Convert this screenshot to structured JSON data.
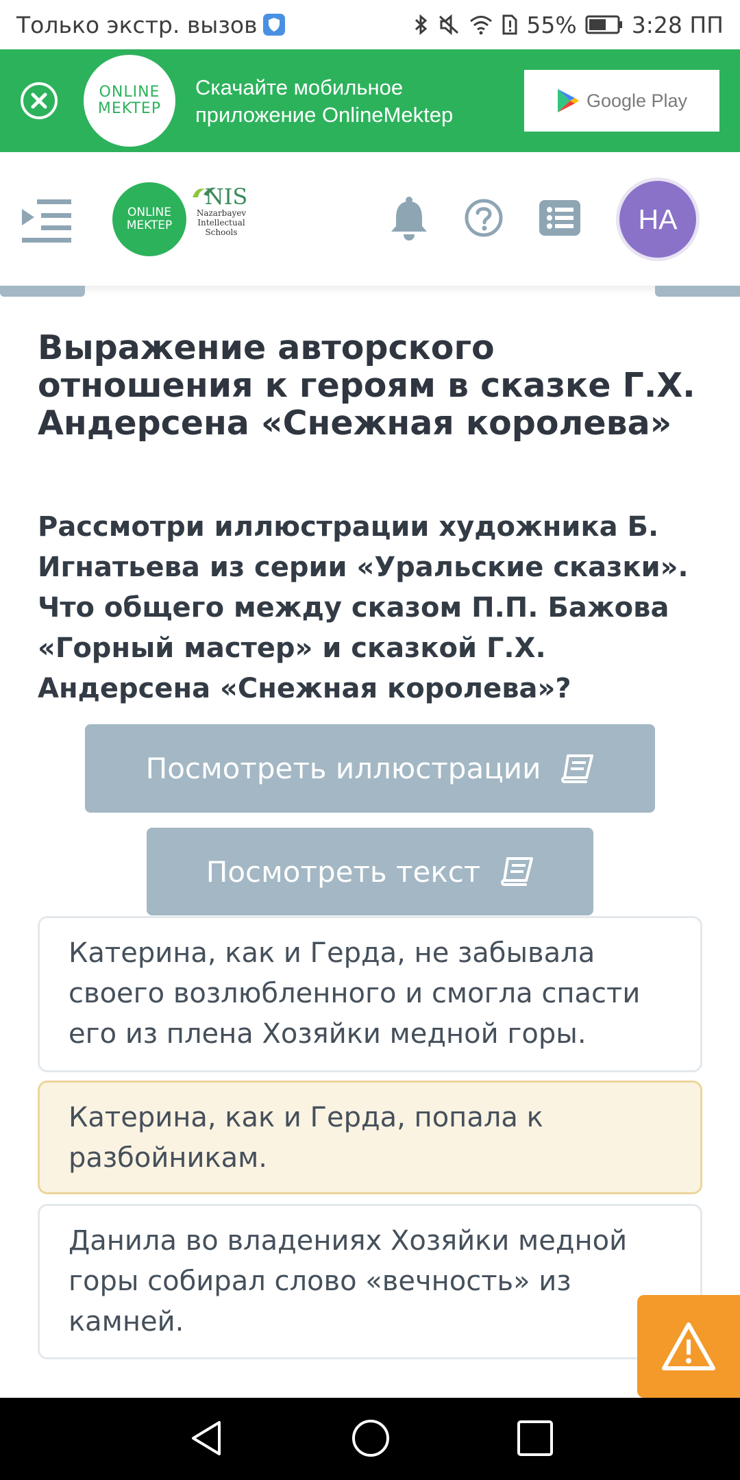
{
  "status_bar": {
    "carrier_text": "Только экстр. вызов",
    "battery": "55%",
    "time": "3:28 ПП",
    "icons": [
      "shield-icon",
      "bluetooth-icon",
      "mute-icon",
      "wifi-icon",
      "sim-alert-icon",
      "battery-icon"
    ]
  },
  "banner": {
    "logo_line1": "ONLINE",
    "logo_line2": "MEKTEP",
    "text": "Скачайте мобильное приложение OnlineMektep",
    "store_label": "Google Play",
    "close_icon": "close-icon"
  },
  "header": {
    "logo_line1": "ONLINE",
    "logo_line2": "MEKTEP",
    "nis_word": "NIS",
    "nis_line1": "Nazarbayev",
    "nis_line2": "Intellectual",
    "nis_line3": "Schools",
    "avatar_initials": "НА",
    "icons": [
      "menu-icon",
      "bell-icon",
      "help-icon",
      "list-icon"
    ]
  },
  "content": {
    "title": "Выражение авторского отношения к героям в сказке Г.Х. Андерсена «Снежная королева»",
    "question": "Рассмотри иллюстрации художника Б. Игнатьева из серии «Уральские сказки». Что общего между сказом П.П. Бажова «Горный мастер» и сказкой Г.Х. Андерсена «Снежная королева»?",
    "buttons": {
      "illustrations": "Посмотреть иллюстрации",
      "text": "Посмотреть текст"
    },
    "answers": [
      "Катерина, как и Герда, не забывала своего возлюбленного и смогла спасти его из плена Хозяйки медной горы.",
      "Катерина, как и Герда, попала к разбойникам.",
      "Данила во владениях Хозяйки медной горы собирал слово «вечность» из камней."
    ]
  },
  "colors": {
    "brand_green": "#2db25c",
    "button_gray_blue": "#a3b7c4",
    "selected_answer_bg": "#fbf3e2",
    "warning_orange": "#f39a2b",
    "avatar_purple": "#8a72c9"
  }
}
